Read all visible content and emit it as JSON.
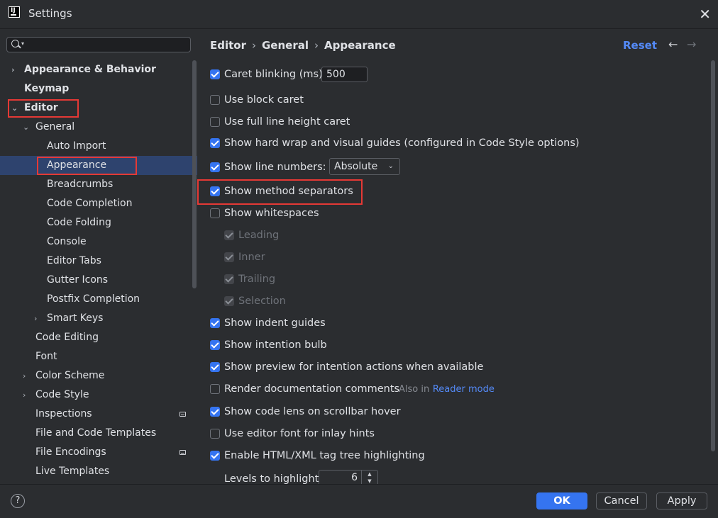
{
  "window": {
    "title": "Settings",
    "app_icon": "intellij-icon",
    "close_icon": "close-icon"
  },
  "sidebar": {
    "search_placeholder": "",
    "items": [
      {
        "label": "Appearance & Behavior",
        "bold": true,
        "expanded": false
      },
      {
        "label": "Keymap",
        "bold": true
      },
      {
        "label": "Editor",
        "bold": true,
        "expanded": true
      },
      {
        "label": "General",
        "expanded": true
      },
      {
        "label": "Auto Import"
      },
      {
        "label": "Appearance",
        "selected": true
      },
      {
        "label": "Breadcrumbs"
      },
      {
        "label": "Code Completion"
      },
      {
        "label": "Code Folding"
      },
      {
        "label": "Console"
      },
      {
        "label": "Editor Tabs"
      },
      {
        "label": "Gutter Icons"
      },
      {
        "label": "Postfix Completion"
      },
      {
        "label": "Smart Keys",
        "expandable": true
      },
      {
        "label": "Code Editing"
      },
      {
        "label": "Font"
      },
      {
        "label": "Color Scheme",
        "expandable": true
      },
      {
        "label": "Code Style",
        "expandable": true
      },
      {
        "label": "Inspections",
        "badge_icon": "project-level-icon"
      },
      {
        "label": "File and Code Templates"
      },
      {
        "label": "File Encodings",
        "badge_icon": "project-level-icon"
      },
      {
        "label": "Live Templates"
      }
    ]
  },
  "header": {
    "breadcrumbs": [
      "Editor",
      "General",
      "Appearance"
    ],
    "reset_label": "Reset",
    "back_icon": "arrow-left-icon",
    "forward_icon": "arrow-right-icon"
  },
  "options": {
    "caret_blinking": {
      "label": "Caret blinking (ms):",
      "checked": true,
      "value": "500"
    },
    "block_caret": {
      "label": "Use block caret",
      "checked": false
    },
    "full_line_height": {
      "label": "Use full line height caret",
      "checked": false
    },
    "hard_wrap": {
      "label": "Show hard wrap and visual guides (configured in Code Style options)",
      "checked": true
    },
    "line_numbers": {
      "label": "Show line numbers:",
      "checked": true,
      "selected": "Absolute"
    },
    "method_separators": {
      "label": "Show method separators",
      "checked": true
    },
    "whitespaces": {
      "label": "Show whitespaces",
      "checked": false
    },
    "leading": {
      "label": "Leading",
      "checked": true,
      "disabled": true
    },
    "inner": {
      "label": "Inner",
      "checked": true,
      "disabled": true
    },
    "trailing": {
      "label": "Trailing",
      "checked": true,
      "disabled": true
    },
    "selection": {
      "label": "Selection",
      "checked": true,
      "disabled": true
    },
    "indent_guides": {
      "label": "Show indent guides",
      "checked": true
    },
    "intention_bulb": {
      "label": "Show intention bulb",
      "checked": true
    },
    "preview_intention": {
      "label": "Show preview for intention actions when available",
      "checked": true
    },
    "render_docs": {
      "label": "Render documentation comments",
      "checked": false,
      "note": "Also in",
      "link": "Reader mode"
    },
    "code_lens": {
      "label": "Show code lens on scrollbar hover",
      "checked": true
    },
    "editor_font_inlay": {
      "label": "Use editor font for inlay hints",
      "checked": false
    },
    "tag_tree": {
      "label": "Enable HTML/XML tag tree highlighting",
      "checked": true
    },
    "levels": {
      "label": "Levels to highlight:",
      "value": "6"
    }
  },
  "footer": {
    "help_label": "?",
    "ok_label": "OK",
    "cancel_label": "Cancel",
    "apply_label": "Apply"
  },
  "colors": {
    "accent": "#3574f0",
    "link": "#548af7",
    "selection": "#2e436e",
    "highlight_box": "#e53935",
    "background": "#2b2d30"
  }
}
